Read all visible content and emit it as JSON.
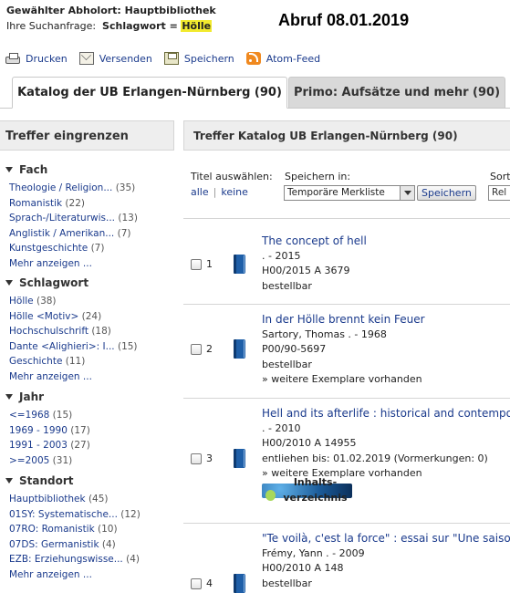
{
  "header": {
    "location_label": "Gewählter Abholort: Hauptbibliothek",
    "query_prefix": "Ihre Suchanfrage:",
    "query_key": "Schlagwort =",
    "query_value": "Hölle",
    "retrieval_note": "Abruf 08.01.2019"
  },
  "toolbar": {
    "items": [
      {
        "label": "Drucken",
        "icon": "print-icon"
      },
      {
        "label": "Versenden",
        "icon": "envelope-icon"
      },
      {
        "label": "Speichern",
        "icon": "save-icon"
      },
      {
        "label": "Atom-Feed",
        "icon": "rss-icon"
      }
    ]
  },
  "tabs": [
    {
      "label": "Katalog der UB Erlangen-Nürnberg (90)",
      "active": true
    },
    {
      "label": "Primo: Aufsätze und mehr (90)",
      "active": false
    }
  ],
  "sidebar": {
    "title": "Treffer eingrenzen",
    "facets": [
      {
        "title": "Fach",
        "items": [
          {
            "label": "Theologie / Religion...",
            "count": "(35)"
          },
          {
            "label": "Romanistik",
            "count": "(22)"
          },
          {
            "label": "Sprach-/Literaturwis...",
            "count": "(13)"
          },
          {
            "label": "Anglistik / Amerikan...",
            "count": "(7)"
          },
          {
            "label": "Kunstgeschichte",
            "count": "(7)"
          },
          {
            "label": "Mehr anzeigen ...",
            "count": ""
          }
        ]
      },
      {
        "title": "Schlagwort",
        "items": [
          {
            "label": "Hölle",
            "count": "(38)"
          },
          {
            "label": "Hölle <Motiv>",
            "count": "(24)"
          },
          {
            "label": "Hochschulschrift",
            "count": "(18)"
          },
          {
            "label": "Dante <Alighieri>: I...",
            "count": "(15)"
          },
          {
            "label": "Geschichte",
            "count": "(11)"
          },
          {
            "label": "Mehr anzeigen ...",
            "count": ""
          }
        ]
      },
      {
        "title": "Jahr",
        "items": [
          {
            "label": "<=1968",
            "count": "(15)"
          },
          {
            "label": "1969 - 1990",
            "count": "(17)"
          },
          {
            "label": "1991 - 2003",
            "count": "(27)"
          },
          {
            "label": ">=2005",
            "count": "(31)"
          }
        ]
      },
      {
        "title": "Standort",
        "items": [
          {
            "label": "Hauptbibliothek",
            "count": "(45)"
          },
          {
            "label": "01SY: Systematische...",
            "count": "(12)"
          },
          {
            "label": "07RO: Romanistik",
            "count": "(10)"
          },
          {
            "label": "07DS: Germanistik",
            "count": "(4)"
          },
          {
            "label": "EZB: Erziehungswisse...",
            "count": "(4)"
          },
          {
            "label": "Mehr anzeigen ...",
            "count": ""
          }
        ]
      }
    ]
  },
  "results": {
    "title": "Treffer Katalog UB Erlangen-Nürnberg (90)",
    "select_label": "Titel auswählen:",
    "select_all": "alle",
    "select_none": "keine",
    "save_in_label": "Speichern in:",
    "save_target": "Temporäre Merkliste",
    "save_button": "Speichern",
    "sort_label": "Sort",
    "sort_value": "Rel",
    "records": [
      {
        "num": "1",
        "title": "The concept of hell",
        "lines": [
          ". - 2015",
          "H00/2015 A 3679"
        ],
        "links": [
          "bestellbar"
        ],
        "toc": false
      },
      {
        "num": "2",
        "title": "In der Hölle brennt kein Feuer",
        "lines": [
          "Sartory, Thomas . - 1968",
          "P00/90-5697"
        ],
        "links": [
          "bestellbar",
          "» weitere Exemplare vorhanden"
        ],
        "toc": false
      },
      {
        "num": "3",
        "title": "Hell and its afterlife : historical and contemporary",
        "lines": [
          ". - 2010",
          "H00/2010 A 14955"
        ],
        "links": [
          "entliehen bis: 01.02.2019 (Vormerkungen: 0)",
          "» weitere Exemplare vorhanden"
        ],
        "toc": true,
        "toc_label_1": "Inhalts-",
        "toc_label_2": "verzeichnis"
      },
      {
        "num": "4",
        "title": "\"Te voilà, c'est la force\" : essai sur \"Une saison",
        "lines": [
          "Frémy, Yann . - 2009",
          "H00/2010 A 148"
        ],
        "links": [
          "bestellbar"
        ],
        "toc": false
      }
    ]
  }
}
